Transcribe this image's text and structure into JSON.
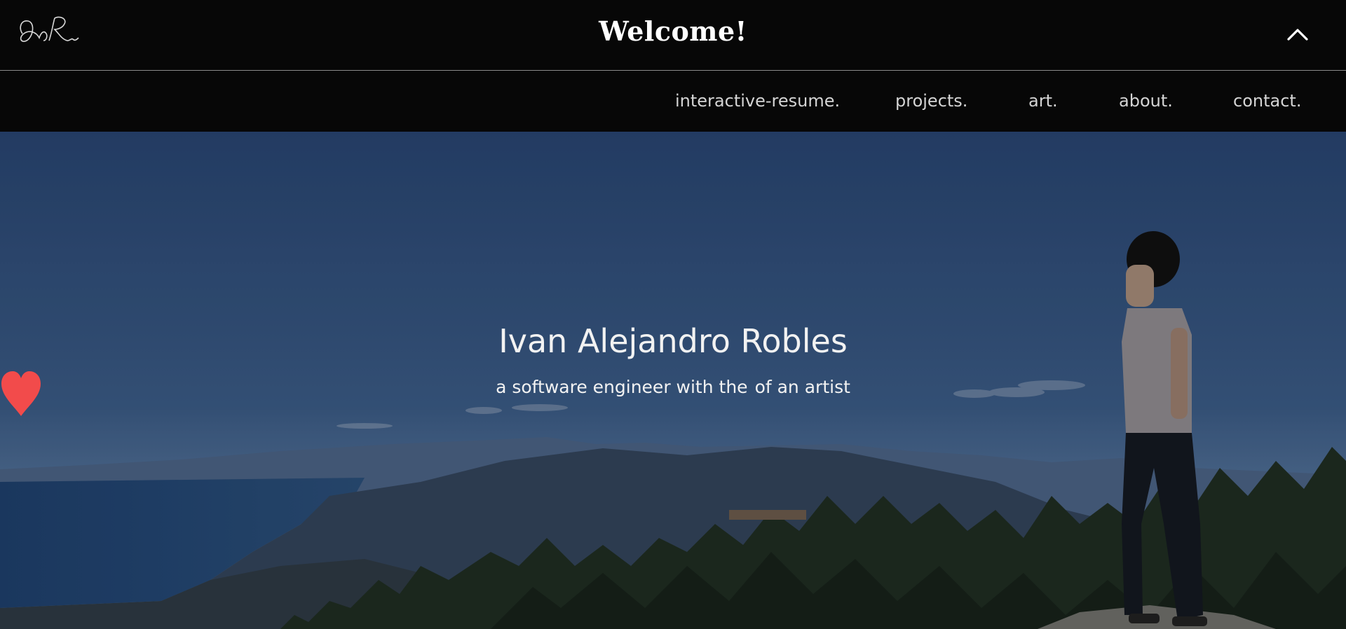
{
  "header": {
    "title": "Welcome!",
    "logo_icon": "signature-logo-icon",
    "collapse_icon": "chevron-up-icon"
  },
  "nav": {
    "items": [
      {
        "label": "interactive-resume."
      },
      {
        "label": "projects."
      },
      {
        "label": "art."
      },
      {
        "label": "about."
      },
      {
        "label": "contact."
      }
    ]
  },
  "hero": {
    "name": "Ivan Alejandro Robles",
    "tagline_before": "a software engineer with the",
    "tagline_after": "of an artist",
    "heart_icon": "heart-icon",
    "heart_color": "#f24b4b",
    "background_image": "mountain-lake-landscape-with-person"
  },
  "colors": {
    "bar_background": "#070707",
    "nav_text": "#d4d4d4",
    "sky": "#2d4b73"
  }
}
